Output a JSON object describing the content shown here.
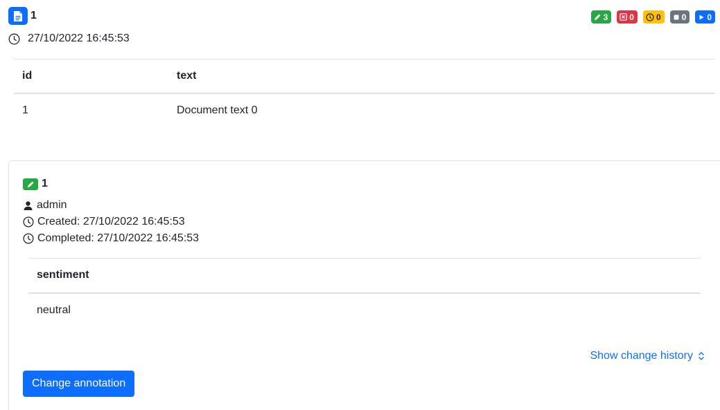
{
  "document": {
    "id": "1",
    "timestamp": "27/10/2022 16:45:53",
    "icon": "document-icon",
    "status_counts": [
      {
        "name": "completed",
        "icon": "pencil-icon",
        "count": "3",
        "color": "#28a745"
      },
      {
        "name": "rejected",
        "icon": "x-icon",
        "count": "0",
        "color": "#dc3545"
      },
      {
        "name": "timed-out",
        "icon": "clock-icon",
        "count": "0",
        "color": "#ffc107"
      },
      {
        "name": "stopped",
        "icon": "stop-icon",
        "count": "0",
        "color": "#6c757d"
      },
      {
        "name": "running",
        "icon": "play-icon",
        "count": "0",
        "color": "#0d6efd"
      }
    ],
    "table": {
      "headers": [
        "id",
        "text"
      ],
      "rows": [
        [
          "1",
          "Document text 0"
        ]
      ]
    }
  },
  "annotation": {
    "id": "1",
    "user": "admin",
    "created": "Created: 27/10/2022 16:45:53",
    "completed": "Completed: 27/10/2022 16:45:53",
    "table": {
      "headers": [
        "sentiment"
      ],
      "rows": [
        [
          "neutral"
        ]
      ]
    },
    "history_link": "Show change history",
    "change_button": "Change annotation"
  },
  "colors": {
    "primary": "#0d6efd",
    "success": "#28a745"
  }
}
